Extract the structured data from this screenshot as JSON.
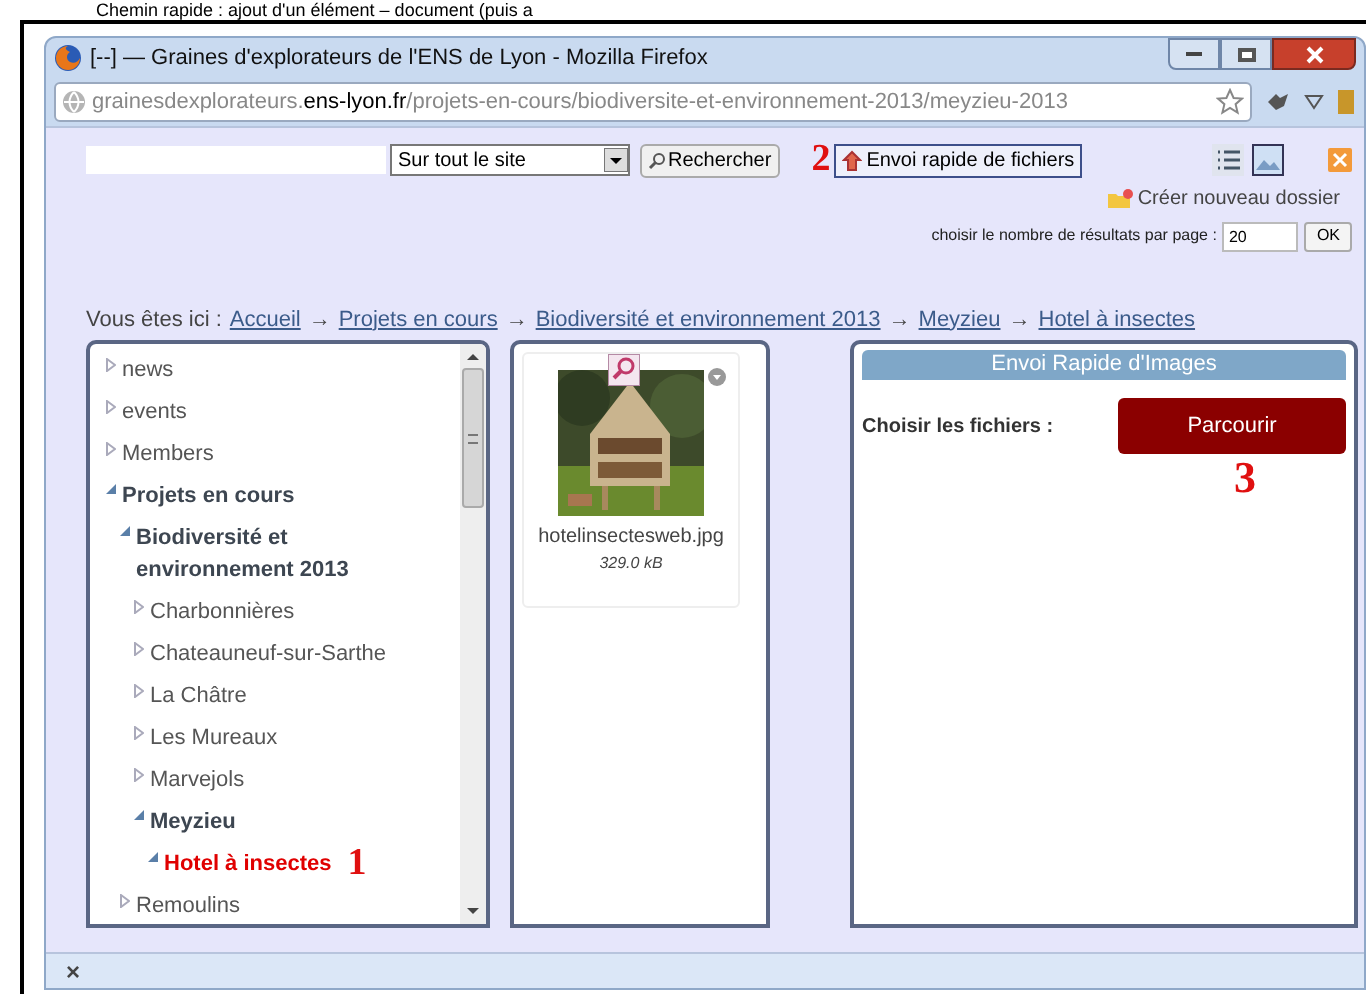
{
  "document_heading": "Chemin rapide : ajout d'un élément – document (puis a",
  "window": {
    "title": "[--] — Graines d'explorateurs de l'ENS de Lyon - Mozilla Firefox"
  },
  "address_bar": {
    "url_start": "grainesdexplorateurs.",
    "url_domain": "ens-lyon.fr",
    "url_path": "/projets-en-cours/biodiversite-et-environnement-2013/meyzieu-2013"
  },
  "toolbar": {
    "scope_select": "Sur tout le site",
    "search_button": "Rechercher",
    "upload_annotation": "2",
    "upload_button": "Envoi rapide de fichiers",
    "new_folder_link": "Créer nouveau dossier",
    "results_label": "choisir le nombre de résultats par page :",
    "results_value": "20",
    "ok_button": "OK"
  },
  "breadcrumb": {
    "label": "Vous êtes ici :",
    "separator": "→",
    "links": [
      "Accueil",
      "Projets en cours",
      "Biodiversité et environnement 2013",
      "Meyzieu",
      "Hotel à insectes"
    ]
  },
  "tree": [
    {
      "label": "news",
      "expanded": false,
      "selected": false
    },
    {
      "label": "events",
      "expanded": false,
      "selected": false
    },
    {
      "label": "Members",
      "expanded": false,
      "selected": false
    },
    {
      "label": "Projets en cours",
      "expanded": true,
      "selected": false,
      "children": [
        {
          "label": "Biodiversité et environnement 2013",
          "expanded": true,
          "selected": false,
          "children": [
            {
              "label": "Charbonnières",
              "expanded": false,
              "selected": false
            },
            {
              "label": "Chateauneuf-sur-Sarthe",
              "expanded": false,
              "selected": false
            },
            {
              "label": "La Châtre",
              "expanded": false,
              "selected": false
            },
            {
              "label": "Les Mureaux",
              "expanded": false,
              "selected": false
            },
            {
              "label": "Marvejols",
              "expanded": false,
              "selected": false
            },
            {
              "label": "Meyzieu",
              "expanded": true,
              "selected": false,
              "children": [
                {
                  "label": "Hotel à insectes",
                  "expanded": true,
                  "selected": true,
                  "annotation": "1"
                }
              ]
            }
          ]
        },
        {
          "label": "Remoulins",
          "expanded": false,
          "selected": false
        }
      ]
    }
  ],
  "files": [
    {
      "kind": "picture",
      "name": "hotelinsectesweb.jpg",
      "size": "329.0 kB"
    }
  ],
  "upload_panel": {
    "title": "Envoi Rapide d'Images",
    "label": "Choisir les fichiers :",
    "button": "Parcourir",
    "annotation": "3"
  },
  "footer": {
    "close": "×"
  }
}
